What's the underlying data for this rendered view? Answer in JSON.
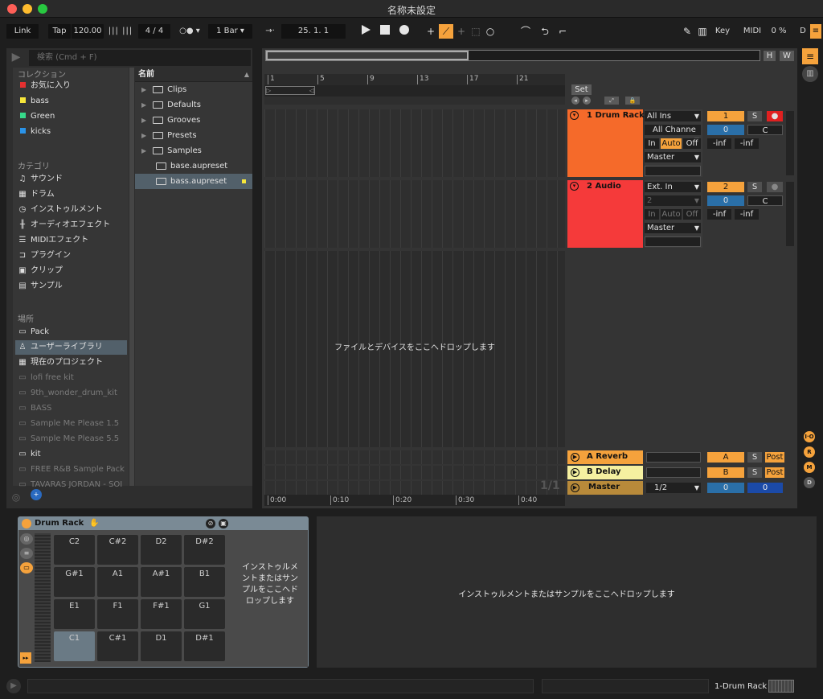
{
  "window": {
    "title": "名称未設定"
  },
  "transport": {
    "link": "Link",
    "tap": "Tap",
    "tempo": "120.00",
    "signature": "4 / 4",
    "quantize": "1 Bar",
    "position": "25.   1.   1",
    "right": {
      "key": "Key",
      "midi": "MIDI",
      "cpu": "0 %",
      "d": "D"
    }
  },
  "search": {
    "placeholder": "検索 (Cmd + F)"
  },
  "browser": {
    "collections_header": "コレクション",
    "collections": [
      {
        "label": "お気に入り",
        "color": "#e53030"
      },
      {
        "label": "bass",
        "color": "#f7e63a"
      },
      {
        "label": "Green",
        "color": "#36d98a"
      },
      {
        "label": "kicks",
        "color": "#2a93e8"
      }
    ],
    "categories_header": "カテゴリ",
    "categories": [
      {
        "label": "サウンド",
        "icon": "music-note-icon"
      },
      {
        "label": "ドラム",
        "icon": "grid-icon"
      },
      {
        "label": "インストゥルメント",
        "icon": "clock-icon"
      },
      {
        "label": "オーディオエフェクト",
        "icon": "waveform-icon"
      },
      {
        "label": "MIDIエフェクト",
        "icon": "midi-icon"
      },
      {
        "label": "プラグイン",
        "icon": "plug-icon"
      },
      {
        "label": "クリップ",
        "icon": "play-box-icon"
      },
      {
        "label": "サンプル",
        "icon": "sample-icon"
      }
    ],
    "places_header": "場所",
    "places": [
      {
        "label": "Pack",
        "icon": "pack-icon",
        "dim": false
      },
      {
        "label": "ユーザーライブラリ",
        "icon": "user-icon",
        "dim": false,
        "selected": true
      },
      {
        "label": "現在のプロジェクト",
        "icon": "project-icon",
        "dim": false
      },
      {
        "label": "lofi free kit",
        "icon": "folder-icon",
        "dim": true
      },
      {
        "label": "9th_wonder_drum_kit",
        "icon": "folder-icon",
        "dim": true
      },
      {
        "label": "BASS",
        "icon": "folder-icon",
        "dim": true
      },
      {
        "label": "Sample Me Please 1.5",
        "icon": "folder-icon",
        "dim": true
      },
      {
        "label": "Sample Me Please 5.5",
        "icon": "folder-icon",
        "dim": true
      },
      {
        "label": "kit",
        "icon": "folder-icon",
        "dim": false
      },
      {
        "label": "FREE R&B Sample Pack",
        "icon": "folder-icon",
        "dim": true
      },
      {
        "label": "TAVARAS JORDAN - SOI",
        "icon": "folder-icon",
        "dim": true
      }
    ],
    "files_header": "名前",
    "files": [
      {
        "label": "Clips",
        "type": "folder"
      },
      {
        "label": "Defaults",
        "type": "folder"
      },
      {
        "label": "Grooves",
        "type": "folder"
      },
      {
        "label": "Presets",
        "type": "folder"
      },
      {
        "label": "Samples",
        "type": "folder"
      },
      {
        "label": "base.aupreset",
        "type": "file"
      },
      {
        "label": "bass.aupreset",
        "type": "file",
        "selected": true
      }
    ]
  },
  "arrangement": {
    "ruler": [
      "1",
      "5",
      "9",
      "13",
      "17",
      "21"
    ],
    "time_ruler": [
      "0:00",
      "0:10",
      "0:20",
      "0:30",
      "0:40"
    ],
    "page": "1/1",
    "drop_text": "ファイルとデバイスをここへドロップします",
    "set_label": "Set",
    "tracks": [
      {
        "name": "1 Drum Rack",
        "color": "#f56a2a",
        "input": "All Ins",
        "channel": "All Channe",
        "monitor": [
          "In",
          "Auto",
          "Off"
        ],
        "output": "Master",
        "number": "1",
        "solo": "S",
        "value": "0",
        "pan": "C",
        "meter_l": "-inf",
        "meter_r": "-inf"
      },
      {
        "name": "2 Audio",
        "color": "#f53a3a",
        "input": "Ext. In",
        "channel": "2",
        "monitor": [
          "In",
          "Auto",
          "Off"
        ],
        "output": "Master",
        "number": "2",
        "solo": "S",
        "value": "0",
        "pan": "C",
        "meter_l": "-inf",
        "meter_r": "-inf"
      }
    ],
    "returns": [
      {
        "name": "A Reverb",
        "letter": "A",
        "solo": "S",
        "post": "Post"
      },
      {
        "name": "B Delay",
        "letter": "B",
        "solo": "S",
        "post": "Post"
      }
    ],
    "master": {
      "name": "Master",
      "output": "1/2",
      "value": "0",
      "value2": "0"
    },
    "side_buttons": [
      "I·O",
      "R",
      "M",
      "D"
    ],
    "hw": [
      "H",
      "W"
    ]
  },
  "device": {
    "title": "Drum Rack",
    "pads": [
      [
        "C2",
        "C#2",
        "D2",
        "D#2"
      ],
      [
        "G#1",
        "A1",
        "A#1",
        "B1"
      ],
      [
        "E1",
        "F1",
        "F#1",
        "G1"
      ],
      [
        "C1",
        "C#1",
        "D1",
        "D#1"
      ]
    ],
    "selected_pad": "C1",
    "drop_small": "インストゥルメントまたはサンプルをここへドロップします",
    "drop_large": "インストゥルメントまたはサンプルをここへドロップします"
  },
  "status": {
    "track": "1-Drum Rack"
  }
}
